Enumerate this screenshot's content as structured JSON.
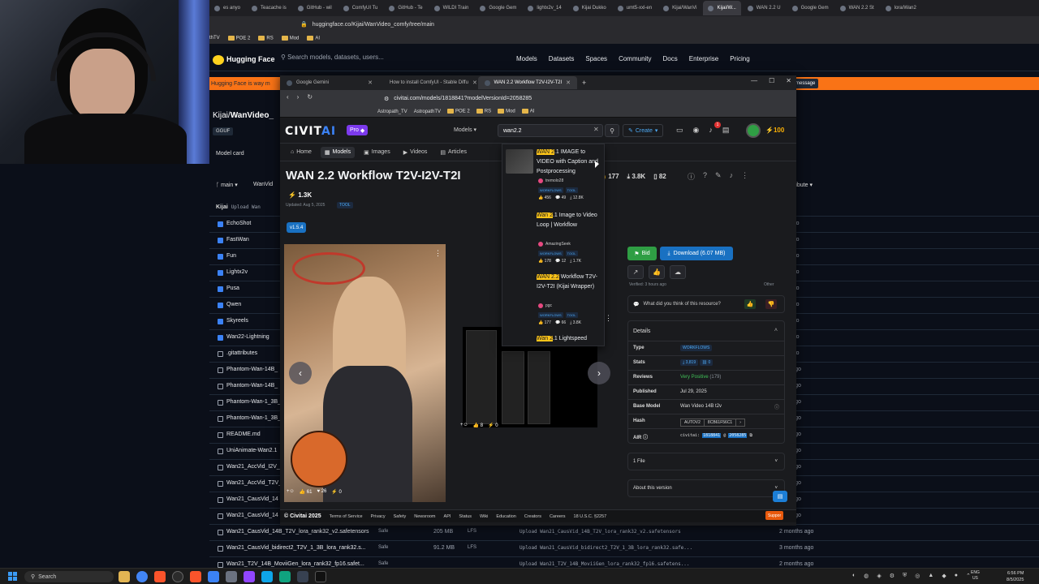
{
  "bg_browser": {
    "tabs": [
      "es anyo",
      "Teacache is",
      "GitHub - wil",
      "ComfyUI Tu",
      "GitHub - Te",
      "WILDI Train",
      "Google Gem",
      "lightx2v_14",
      "Kijai Dukko",
      "umt5-xxl-en",
      "Kijai/WanVi",
      "Kijai/W...",
      "WAN 2.2 U",
      "Google Gem",
      "WAN 2.2 St",
      "lora/Wan2"
    ],
    "url": "huggingface.co/Kijai/WanVideo_comfy/tree/main",
    "bookmarks": [
      "thTV",
      "POE 2",
      "RS",
      "Mod",
      "AI"
    ]
  },
  "hf": {
    "brand": "Hugging Face",
    "search_placeholder": "Search models, datasets, users...",
    "nav": [
      "Models",
      "Datasets",
      "Spaces",
      "Community",
      "Docs",
      "Enterprise",
      "Pricing"
    ],
    "banner": "Hugging Face is way m",
    "message_btn": "message",
    "repo_owner": "Kijai/",
    "repo_name": "WanVideo_",
    "gguf_tag": "GGUF",
    "model_card_tab": "Model card",
    "branch": "main",
    "breadcrumb": "WanVid",
    "contribute": "ribute",
    "commit_user": "Kijai",
    "commit_msg": "Upload Wan",
    "rows": [
      {
        "name": "EchoShot",
        "ago": "ays ago",
        "folder": true
      },
      {
        "name": "FastWan",
        "ago": "ays ago",
        "folder": true
      },
      {
        "name": "Fun",
        "ago": "ays ago",
        "folder": true
      },
      {
        "name": "Lightx2v",
        "ago": "ays ago",
        "folder": true
      },
      {
        "name": "Pusa",
        "ago": "ays ago",
        "folder": true
      },
      {
        "name": "Qwen",
        "ago": "ays ago",
        "folder": true
      },
      {
        "name": "Skyreels",
        "ago": "ays ago",
        "folder": true
      },
      {
        "name": "Wan22-Lightning",
        "ago": "ays ago",
        "folder": true
      },
      {
        "name": ".gitattributes",
        "ago": "ays ago",
        "folder": false
      },
      {
        "name": "Phantom-Wan-14B_",
        "ago": "nths ago",
        "folder": false
      },
      {
        "name": "Phantom-Wan-14B_",
        "ago": "nths ago",
        "folder": false
      },
      {
        "name": "Phantom-Wan-1_3B_",
        "ago": "nths ago",
        "folder": false
      },
      {
        "name": "Phantom-Wan-1_3B_",
        "ago": "nths ago",
        "folder": false
      },
      {
        "name": "README.md",
        "ago": "nths ago",
        "folder": false
      },
      {
        "name": "UniAnimate-Wan2.1",
        "ago": "nths ago",
        "folder": false
      },
      {
        "name": "Wan21_AccVid_I2V_",
        "ago": "nths ago",
        "folder": false
      },
      {
        "name": "Wan21_AccVid_T2V_",
        "ago": "nths ago",
        "folder": false
      },
      {
        "name": "Wan21_CausVid_14",
        "ago": "nths ago",
        "folder": false
      },
      {
        "name": "Wan21_CausVid_14",
        "ago": "nths ago",
        "folder": false
      },
      {
        "name": "Wan21_CausVid_14B_T2V_lora_rank32_v2.safetensors",
        "safe": "Safe",
        "size": "205 MB",
        "lfs": "LFS",
        "msg": "Upload Wan21_CausVid_14B_T2V_lora_rank32_v2.safetensors",
        "ago": "2 months ago",
        "folder": false
      },
      {
        "name": "Wan21_CausVid_bidirect2_T2V_1_3B_lora_rank32.s...",
        "safe": "Safe",
        "size": "91.2 MB",
        "lfs": "LFS",
        "msg": "Upload Wan21_CausVid_bidirect2_T2V_1_3B_lora_rank32.safe...",
        "ago": "3 months ago",
        "folder": false
      },
      {
        "name": "Wan21_T2V_14B_MoviiGen_lora_rank32_fp16.safet...",
        "safe": "Safe",
        "size": "",
        "lfs": "",
        "msg": "Upload Wan21_T2V_14B_MoviiGen_lora_rank32_fp16.safetens...",
        "ago": "2 months ago",
        "folder": false
      }
    ]
  },
  "fg_browser": {
    "tabs": [
      {
        "label": "Google Gemini",
        "active": false
      },
      {
        "label": "How to install ComfyUI - Stable Diffu",
        "active": false
      },
      {
        "label": "WAN 2.2 Workflow T2V-I2V-T2I",
        "active": true
      }
    ],
    "url": "civitai.com/models/1818841?modelVersionId=2058285",
    "bookmarks": [
      "Astropath_TV",
      "AstropathTV",
      "POE 2",
      "RS",
      "Mod",
      "AI"
    ]
  },
  "civitai": {
    "logo_a": "CIVIT",
    "logo_b": "AI",
    "pro": "Pro",
    "search_scope": "Models",
    "search_value": "wan2.2",
    "create": "Create",
    "notif_count": "1",
    "buzz": "100",
    "nav": [
      "Home",
      "Models",
      "Images",
      "Videos",
      "Articles"
    ],
    "title": "WAN 2.2 Workflow T2V-I2V-T2I",
    "likes": "1.3K",
    "updated": "Updated: Aug 5, 2025",
    "tool_tag": "TOOL",
    "version": "v1.5.4",
    "stats": {
      "likes": "177",
      "downloads": "3.8K",
      "collections": "82"
    },
    "img1_stats": {
      "likes": "61",
      "hearts": "26",
      "tips": "0"
    },
    "img2_stats": {
      "likes": "8",
      "tips": "0"
    },
    "bid": "Bid",
    "download": "Download (6.07 MB)",
    "verified": "Verified: 3 hours ago",
    "other": "Other",
    "feedback": "What did you think of this resource?",
    "details_header": "Details",
    "details": {
      "type_k": "Type",
      "type_v": "WORKFLOWS",
      "stats_k": "Stats",
      "stats_dl": "3,819",
      "stats_gen": "0",
      "reviews_k": "Reviews",
      "reviews_v": "Very Positive",
      "reviews_n": "(179)",
      "published_k": "Published",
      "published_v": "Jul 29, 2025",
      "base_k": "Base Model",
      "base_v": "Wan Video 14B t2v",
      "hash_k": "Hash",
      "hash_type": "AUTOV2",
      "hash_v": "8CB61F56C1",
      "air_k": "AIR",
      "air_prefix": "civitai:",
      "air_model": "1818841",
      "air_at": "@",
      "air_ver": "2058285"
    },
    "file_section": "1 File",
    "about_section": "About this version",
    "footer": [
      "© Civitai 2025",
      "Terms of Service",
      "Privacy",
      "Safety",
      "Newsroom",
      "API",
      "Status",
      "Wiki",
      "Education",
      "Creators",
      "Careers",
      "18 U.S.C. §2257"
    ],
    "support": "Suppor"
  },
  "dropdown": [
    {
      "title_hl": "WAN 2",
      "title_rest": ".1 IMAGE to VIDEO with Caption and Postprocessing",
      "author": "tremolo28",
      "tags": [
        "WORKFLOWS",
        "TOOL"
      ],
      "stats": [
        "456",
        "49",
        "12.8K"
      ]
    },
    {
      "title_hl": "Wan 2",
      "title_rest": ".1 Image to Video Loop | Workflow",
      "author": "AmazingSeek",
      "tags": [
        "WORKFLOWS",
        "TOOL"
      ],
      "stats": [
        "178",
        "12",
        "1.7K"
      ]
    },
    {
      "title_hl": "WAN 2.2",
      "title_rest": " Workflow T2V-I2V-T2I (Kijai Wrapper)",
      "author": "pgc",
      "tags": [
        "WORKFLOWS",
        "TOOL"
      ],
      "stats": [
        "177",
        "66",
        "3.8K"
      ]
    },
    {
      "title_hl": "Wan 2",
      "title_rest": ".1 Lightspeed",
      "author": "",
      "tags": [],
      "stats": []
    }
  ],
  "taskbar": {
    "search": "Search",
    "lang1": "ENG",
    "lang2": "US",
    "time": "6:56 PM",
    "date": "8/5/2025"
  }
}
